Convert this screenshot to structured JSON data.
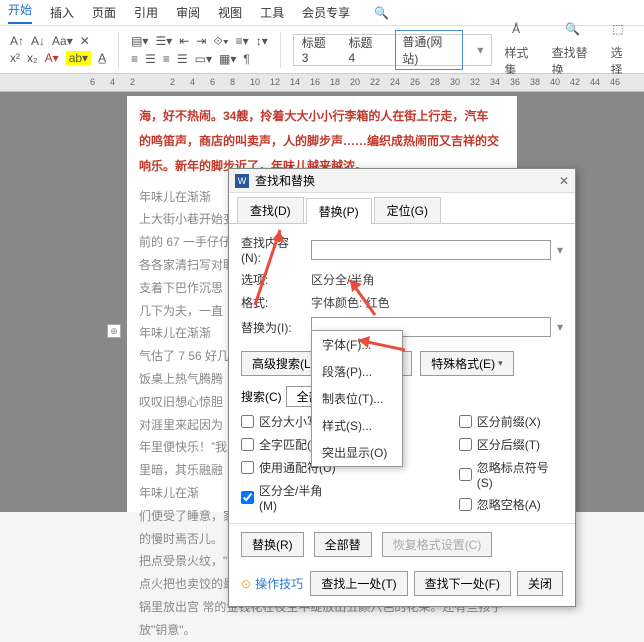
{
  "ribbon": {
    "tabs": [
      "开始",
      "插入",
      "页面",
      "引用",
      "审阅",
      "视图",
      "工具",
      "会员专享"
    ],
    "active": "开始",
    "styles": {
      "h3": "标题 3",
      "h4": "标题 4",
      "normal": "普通(网站)"
    },
    "big": {
      "styleset": "样式集",
      "findrep": "查找替换",
      "select": "选择"
    }
  },
  "ruler": {
    "ticks": [
      "6",
      "4",
      "2",
      "",
      "2",
      "4",
      "6",
      "8",
      "10",
      "12",
      "14",
      "16",
      "18",
      "20",
      "22",
      "24",
      "26",
      "28",
      "30",
      "32",
      "34",
      "36",
      "38",
      "40",
      "42",
      "44",
      "46"
    ]
  },
  "doc": {
    "line1": "海，好不热闹。34艘，拎着大大小小行李箱的人在街上行走，汽车",
    "line2": "的鸣笛声，商店的叫卖声，人的脚步声……编织成热闹而又吉祥的交",
    "line3": "响乐。新年的脚步近了，年味儿越来越浓。",
    "gray": "        年味儿在渐渐\n上大街小巷开始变\n前的 67 一手仔仔\n各各家清扫写对联\n支着下巴作沉思\n几下为夫，一直\n    年味儿在渐渐\n气估了 7 56 好几天\n饭桌上热气腾腾\n叹叹旧想心惊胆\n对涯里来起因为\n年里便快乐！”我\n里暗，其乐融融\n    年味儿在渐\n们便受了睡意，家\n的慢时焉否儿。\n把点受景火纹，\"\n点火把也卖饺的最\n锅里放出宫 常的金钱花在夜空中绽放出五颜六色的花朵。还有些孩子放\"钥意\"。"
  },
  "dialog": {
    "title": "查找和替换",
    "tabs": {
      "find": "查找(D)",
      "replace": "替换(P)",
      "goto": "定位(G)"
    },
    "labels": {
      "findwhat": "查找内容(N):",
      "options": "选项:",
      "optval": "区分全/半角",
      "format": "格式:",
      "fmtval": "字体颜色: 红色",
      "replacewith": "替换为(I):"
    },
    "buttons": {
      "advsearch": "高级搜索(L)",
      "format": "格式(O)",
      "special": "特殊格式(E)",
      "replace": "替换(R)",
      "replaceall": "全部替",
      "resetfmt": "恢复格式设置(C)",
      "findprev": "查找上一处(T)",
      "findnext": "查找下一处(F)",
      "close": "关闭"
    },
    "search": {
      "label": "搜索(C)",
      "value": "全部"
    },
    "checks": {
      "case": "区分大小写(H)",
      "whole": "全字匹配(Y)",
      "wildcard": "使用通配符(U)",
      "width": "区分全/半角(M)",
      "prefix": "区分前缀(X)",
      "suffix": "区分后缀(T)",
      "punct": "忽略标点符号(S)",
      "space": "忽略空格(A)"
    },
    "tip": "操作技巧"
  },
  "dropdown": {
    "font": "字体(F)...",
    "para": "段落(P)...",
    "tabs": "制表位(T)...",
    "style": "样式(S)...",
    "highlight": "突出显示(O)"
  }
}
